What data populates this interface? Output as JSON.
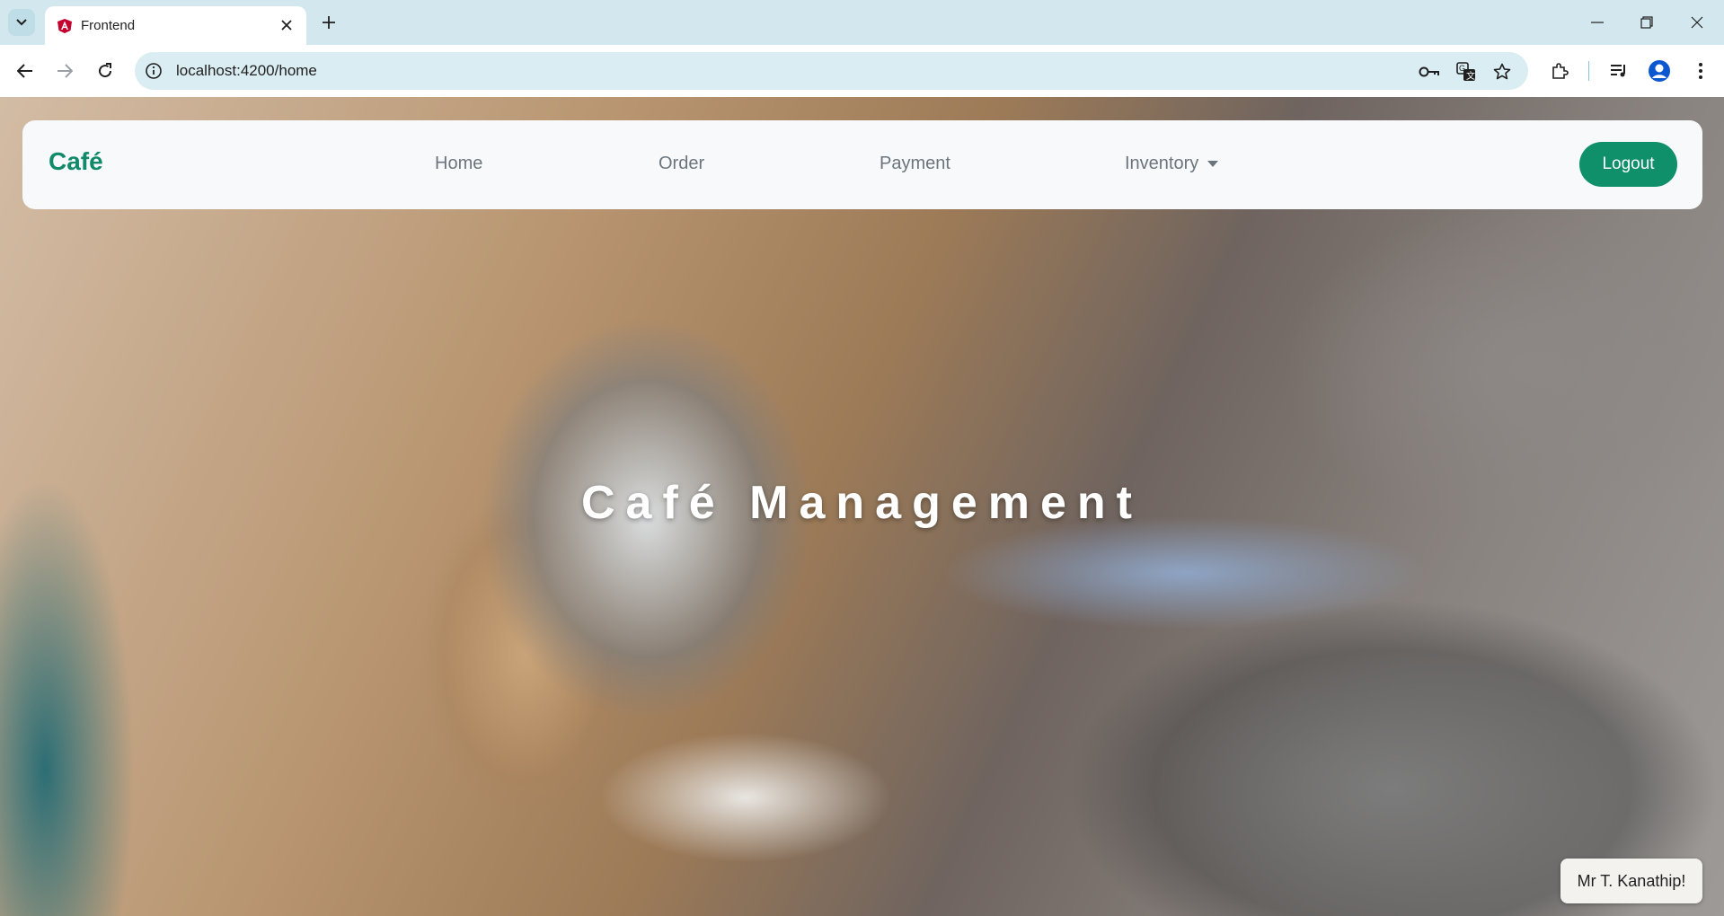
{
  "browser": {
    "tab_title": "Frontend",
    "url": "localhost:4200/home"
  },
  "navbar": {
    "brand": "Café",
    "links": [
      "Home",
      "Order",
      "Payment",
      "Inventory"
    ],
    "logout_label": "Logout"
  },
  "hero": {
    "title": "Café Management"
  },
  "user_badge": "Mr T. Kanathip!",
  "colors": {
    "brand": "#118a6b",
    "logout_button": "#0f8f6a",
    "tabbar": "#d3e8ee"
  },
  "icons": [
    "tab-search-icon",
    "angular-favicon-icon",
    "close-icon",
    "plus-icon",
    "minimize-icon",
    "restore-icon",
    "window-close-icon",
    "back-arrow-icon",
    "forward-arrow-icon",
    "reload-icon",
    "site-info-icon",
    "password-key-icon",
    "translate-icon",
    "star-icon",
    "extensions-icon",
    "media-icon",
    "profile-icon",
    "menu-dots-icon",
    "caret-down-icon"
  ]
}
